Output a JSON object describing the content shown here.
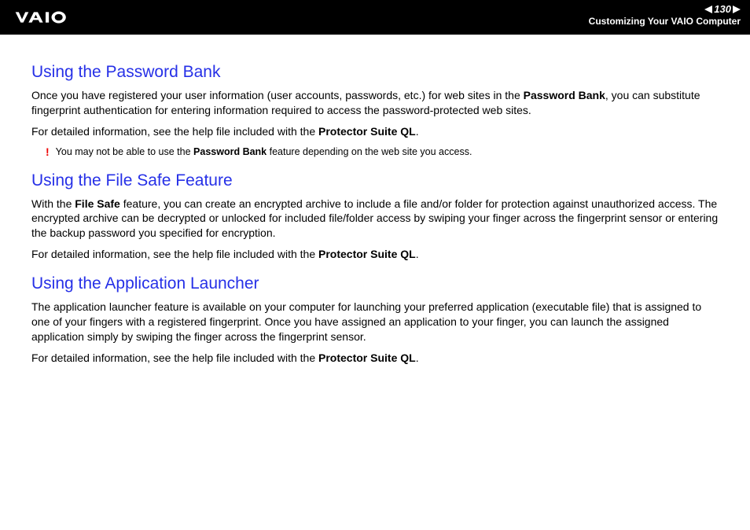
{
  "header": {
    "page_number": "130",
    "section_title": "Customizing Your VAIO Computer"
  },
  "sections": [
    {
      "heading": "Using the Password Bank",
      "paragraphs": [
        {
          "parts": [
            {
              "t": "Once you have registered your user information (user accounts, passwords, etc.) for web sites in the "
            },
            {
              "t": "Password Bank",
              "b": true
            },
            {
              "t": ", you can substitute fingerprint authentication for entering information required to access the password-protected web sites."
            }
          ]
        },
        {
          "parts": [
            {
              "t": "For detailed information, see the help file included with the "
            },
            {
              "t": "Protector Suite QL",
              "b": true
            },
            {
              "t": "."
            }
          ]
        }
      ],
      "note": {
        "parts": [
          {
            "t": "You may not be able to use the "
          },
          {
            "t": "Password Bank",
            "b": true
          },
          {
            "t": " feature depending on the web site you access."
          }
        ]
      }
    },
    {
      "heading": "Using the File Safe Feature",
      "paragraphs": [
        {
          "parts": [
            {
              "t": "With the "
            },
            {
              "t": "File Safe",
              "b": true
            },
            {
              "t": " feature, you can create an encrypted archive to include a file and/or folder for protection against unauthorized access. The encrypted archive can be decrypted or unlocked for included file/folder access by swiping your finger across the fingerprint sensor or entering the backup password you specified for encryption."
            }
          ]
        },
        {
          "parts": [
            {
              "t": "For detailed information, see the help file included with the "
            },
            {
              "t": "Protector Suite QL",
              "b": true
            },
            {
              "t": "."
            }
          ]
        }
      ]
    },
    {
      "heading": "Using the Application Launcher",
      "paragraphs": [
        {
          "parts": [
            {
              "t": "The application launcher feature is available on your computer for launching your preferred application (executable file) that is assigned to one of your fingers with a registered fingerprint. Once you have assigned an application to your finger, you can launch the assigned application simply by swiping the finger across the fingerprint sensor."
            }
          ]
        },
        {
          "parts": [
            {
              "t": "For detailed information, see the help file included with the "
            },
            {
              "t": "Protector Suite QL",
              "b": true
            },
            {
              "t": "."
            }
          ]
        }
      ]
    }
  ]
}
